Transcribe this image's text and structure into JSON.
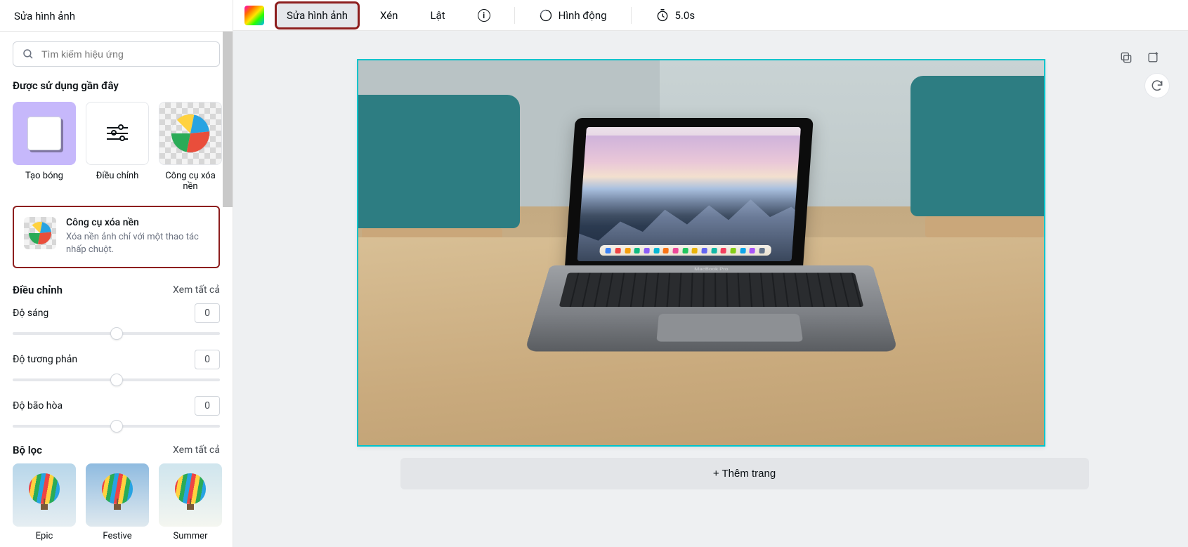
{
  "sidebar": {
    "title": "Sửa hình ảnh",
    "search_placeholder": "Tìm kiếm hiệu ứng",
    "recent_heading": "Được sử dụng gần đây",
    "recent_items": [
      {
        "label": "Tạo bóng"
      },
      {
        "label": "Điều chỉnh"
      },
      {
        "label": "Công cụ xóa nền"
      }
    ],
    "bg_remover": {
      "title": "Công cụ xóa nền",
      "desc": "Xóa nền ảnh chỉ với một thao tác nhấp chuột."
    },
    "adjust": {
      "heading": "Điều chỉnh",
      "see_all": "Xem tất cả",
      "items": [
        {
          "label": "Độ sáng",
          "value": "0"
        },
        {
          "label": "Độ tương phản",
          "value": "0"
        },
        {
          "label": "Độ bão hòa",
          "value": "0"
        }
      ]
    },
    "filters": {
      "heading": "Bộ lọc",
      "see_all": "Xem tất cả",
      "items": [
        {
          "label": "Epic"
        },
        {
          "label": "Festive"
        },
        {
          "label": "Summer"
        }
      ]
    }
  },
  "toolbar": {
    "edit_image": "Sửa hình ảnh",
    "crop": "Xén",
    "flip": "Lật",
    "animate": "Hình động",
    "duration": "5.0s"
  },
  "canvas": {
    "laptop_brand": "MacBook Pro"
  },
  "footer": {
    "add_page": "+ Thêm trang"
  }
}
